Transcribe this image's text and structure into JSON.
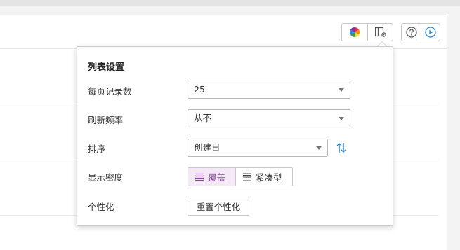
{
  "toolbar": {
    "color_icon": "color-palette-icon",
    "layout_icon": "layout-settings-icon",
    "help_icon": "help-icon",
    "play_icon": "play-icon"
  },
  "popover": {
    "title": "列表设置",
    "rows": {
      "records_per_page": {
        "label": "每页记录数",
        "value": "25"
      },
      "refresh_rate": {
        "label": "刷新频率",
        "value": "从不"
      },
      "sort": {
        "label": "排序",
        "value": "创建日"
      },
      "density": {
        "label": "显示密度",
        "options": [
          "覆盖",
          "紧凑型"
        ],
        "selected": "覆盖"
      },
      "personalize": {
        "label": "个性化",
        "button": "重置个性化"
      }
    }
  },
  "colors": {
    "accent_purple": "#8a4a9a",
    "accent_bg": "#f3e8f5",
    "link_blue": "#2a8ad6"
  }
}
